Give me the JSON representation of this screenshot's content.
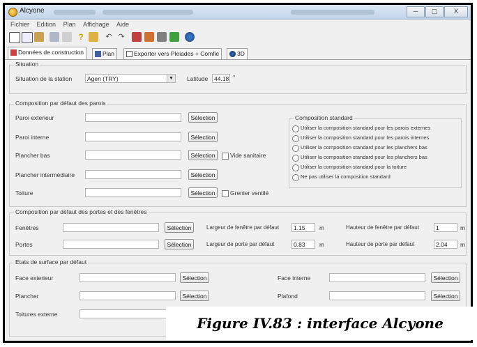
{
  "window": {
    "title": "Alcyone",
    "minimize": "─",
    "maximize": "▢",
    "close": "X"
  },
  "menu": [
    "Fichier",
    "Edition",
    "Plan",
    "Affichage",
    "Aide"
  ],
  "tabs": [
    {
      "label": "Données de construction"
    },
    {
      "label": "Plan"
    },
    {
      "label": "Exporter vers Pleiades + Comfie"
    },
    {
      "label": "3D"
    }
  ],
  "situation": {
    "group_label": "Situation",
    "station_label": "Situation de la station",
    "station_value": "Agen (TRY)",
    "latitude_label": "Latitude",
    "latitude_value": "44.18",
    "latitude_unit": "°"
  },
  "parois": {
    "group_label": "Composition par défaut des parois",
    "select_label": "Sélection",
    "rows": [
      {
        "label": "Paroi exterieur"
      },
      {
        "label": "Paroi interne"
      },
      {
        "label": "Plancher bas",
        "checkbox": "Vide sanitaire"
      },
      {
        "label": "Plancher intermédiaire"
      },
      {
        "label": "Toiture",
        "checkbox": "Grenier ventilé"
      }
    ],
    "standard": {
      "group_label": "Composition standard",
      "options": [
        "Utiliser la composition standard pour les parois externes",
        "Utiliser la composition standard pour les parois internes",
        "Utiliser la composition standard pour les planchers bas",
        "Utiliser la composition standard pour les planchers bas",
        "Utiliser la composition standard pour la toiture",
        "Ne pas utiliser la composition standard"
      ]
    }
  },
  "portes": {
    "group_label": "Composition par défaut des portes et des fenêtres",
    "select_label": "Sélection",
    "rows": [
      {
        "label": "Fenêtres",
        "width_label": "Largeur de fenêtre par défaut",
        "width_value": "1.15",
        "height_label": "Hauteur de fenêtre par défaut",
        "height_value": "1"
      },
      {
        "label": "Portes",
        "width_label": "Largeur de porte par défaut",
        "width_value": "0.83",
        "height_label": "Hauteur de porte par défaut",
        "height_value": "2.04"
      }
    ],
    "unit": "m"
  },
  "surfaces": {
    "group_label": "Etats de surface par défaut",
    "select_label": "Sélection",
    "left": [
      "Face exterieur",
      "Plancher",
      "Toitures externe"
    ],
    "right": [
      "Face interne",
      "Plafond"
    ]
  },
  "caption": "Figure IV.83 : interface Alcyone"
}
